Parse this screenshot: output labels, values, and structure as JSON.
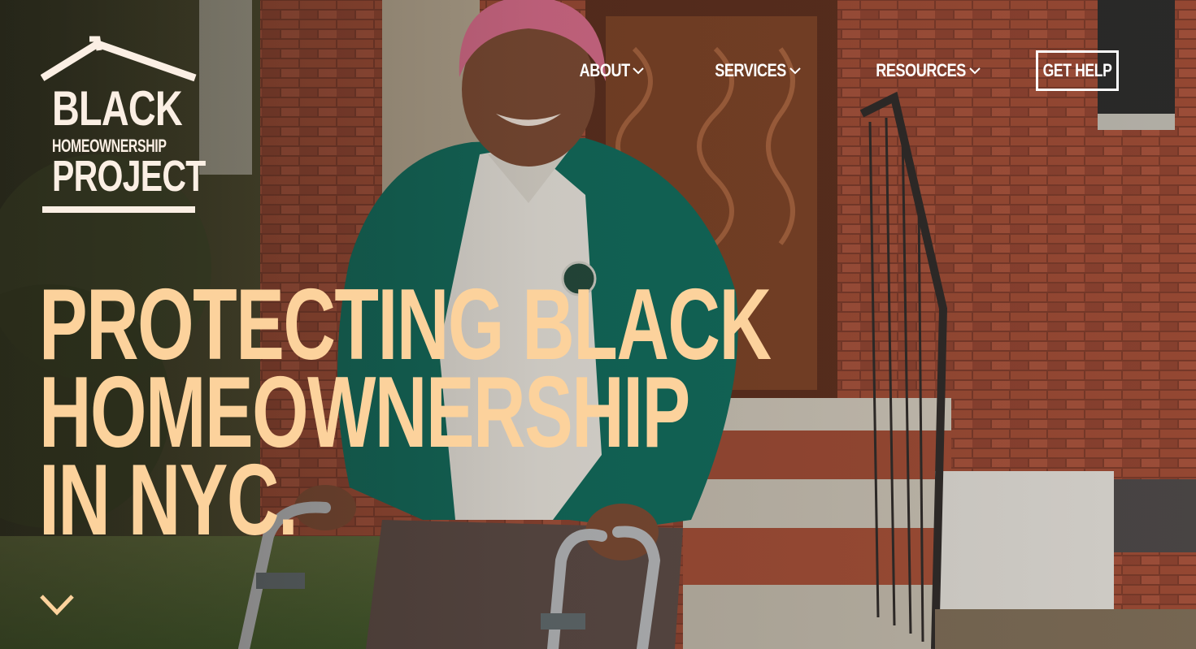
{
  "brand": {
    "line1": "BLACK",
    "line2": "HOMEOWNERSHIP",
    "line3": "PROJECT",
    "logo_icon": "house-roof-icon"
  },
  "nav": {
    "items": [
      {
        "label": "ABOUT",
        "icon": "chevron-down-icon"
      },
      {
        "label": "SERVICES",
        "icon": "chevron-down-icon"
      },
      {
        "label": "RESOURCES",
        "icon": "chevron-down-icon"
      }
    ],
    "cta_label": "GET HELP"
  },
  "hero": {
    "headline": [
      "PROTECTING BLACK",
      "HOMEOWNERSHIP",
      "IN NYC."
    ],
    "scroll_icon": "chevron-down-icon"
  },
  "colors": {
    "headline": "#fcd29c",
    "logo": "#fbefe4",
    "nav_text": "#ffffff"
  }
}
